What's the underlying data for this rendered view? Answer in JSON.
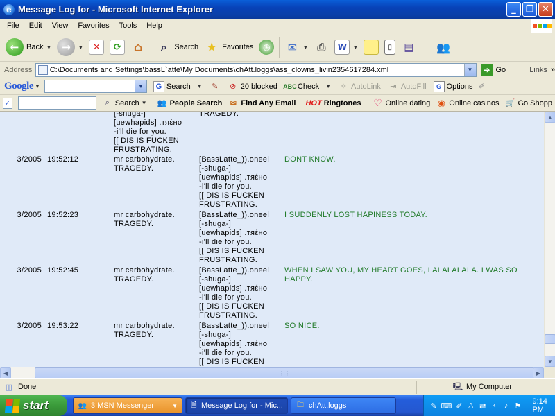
{
  "window": {
    "title": "Message Log for - Microsoft Internet Explorer",
    "min_glyph": "_",
    "max_glyph": "❐",
    "close_glyph": "✕"
  },
  "menu": [
    "File",
    "Edit",
    "View",
    "Favorites",
    "Tools",
    "Help"
  ],
  "toolbar": {
    "back": "Back",
    "search": "Search",
    "favorites": "Favorites"
  },
  "address": {
    "label": "Address",
    "value": "C:\\Documents and Settings\\bassL`atte\\My Documents\\chAtt.loggs\\ass_clowns_livin2354617284.xml",
    "go": "Go",
    "links": "Links"
  },
  "google_bar": {
    "logo": "Google",
    "search": "Search",
    "blocked": "20 blocked",
    "check": "Check",
    "autolink": "AutoLink",
    "autofill": "AutoFill",
    "options": "Options"
  },
  "search_bar": {
    "search": "Search",
    "people_search": "People Search",
    "find_email": "Find Any Email",
    "hot": "HOT",
    "ringtones": "Ringtones",
    "dating": "Online dating",
    "casinos": "Online casinos",
    "shop": "Go Shopp"
  },
  "log": {
    "partial_top": {
      "from": "[-shuga-]\n[uewhapids] .тяέнο\n-i'll die for you.\n[[ DIS IS FUCKEN\nFRUSTRATING.",
      "to": "TRAGEDY."
    },
    "rows": [
      {
        "date": "3/2005",
        "time": "19:52:12",
        "from": "mr carbohydrate.\nTRAGEDY.",
        "to": "[BassLatte_)).oneel\n[-shuga-]\n[uewhapids] .тяέнο\n-i'll die for you.\n[[ DIS IS FUCKEN\nFRUSTRATING.",
        "message": "DONT KNOW."
      },
      {
        "date": "3/2005",
        "time": "19:52:23",
        "from": "mr carbohydrate.\nTRAGEDY.",
        "to": "[BassLatte_)).oneel\n[-shuga-]\n[uewhapids] .тяέнο\n-i'll die for you.\n[[ DIS IS FUCKEN\nFRUSTRATING.",
        "message": "I SUDDENLY LOST HAPINESS TODAY."
      },
      {
        "date": "3/2005",
        "time": "19:52:45",
        "from": "mr carbohydrate.\nTRAGEDY.",
        "to": "[BassLatte_)).oneel\n[-shuga-]\n[uewhapids] .тяέнο\n-i'll die for you.\n[[ DIS IS FUCKEN\nFRUSTRATING.",
        "message": "WHEN I SAW YOU, MY HEART GOES, LALALALALA. I WAS SO HAPPY."
      },
      {
        "date": "3/2005",
        "time": "19:53:22",
        "from": "mr carbohydrate.\nTRAGEDY.",
        "to": "[BassLatte_)).oneel\n[-shuga-]\n[uewhapids] .тяέнο\n-i'll die for you.\n[[ DIS IS FUCKEN",
        "message": "SO NICE."
      }
    ]
  },
  "status": {
    "text": "Done",
    "zone": "My Computer"
  },
  "taskbar": {
    "start": "start",
    "buttons": [
      {
        "label": "3 MSN Messenger"
      },
      {
        "label": "Message Log for - Mic..."
      },
      {
        "label": "chAtt.loggs"
      }
    ],
    "clock": "9:14 PM"
  },
  "colors": {
    "message_text": "#207a28",
    "content_bg": "#e0eaf8",
    "title_bar": "#0a5fd8"
  }
}
